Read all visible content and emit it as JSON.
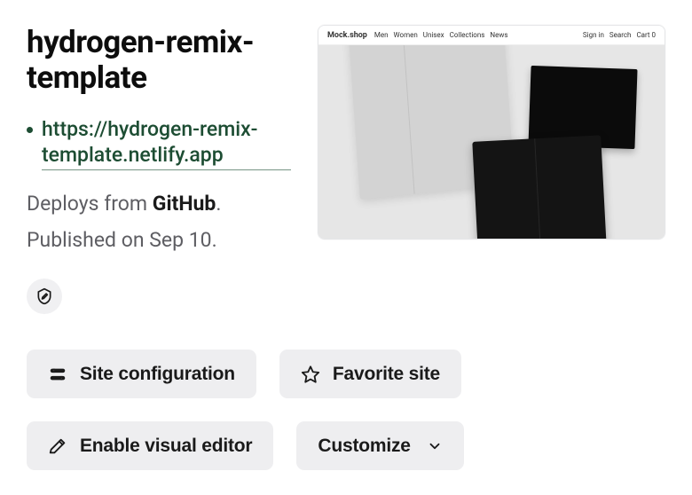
{
  "site": {
    "title": "hydrogen-remix-template",
    "url": "https://hydrogen-remix-template.netlify.app",
    "deploy_prefix": "Deploys from ",
    "deploy_source": "GitHub",
    "deploy_suffix": ".",
    "published_prefix": "Published on ",
    "published_date": "Sep 10",
    "published_suffix": "."
  },
  "preview": {
    "brand": "Mock.shop",
    "nav": [
      "Men",
      "Women",
      "Unisex",
      "Collections",
      "News"
    ],
    "right": [
      "Sign in",
      "Search",
      "Cart 0"
    ]
  },
  "buttons": {
    "site_config": "Site configuration",
    "favorite": "Favorite site",
    "visual_editor": "Enable visual editor",
    "customize": "Customize"
  }
}
